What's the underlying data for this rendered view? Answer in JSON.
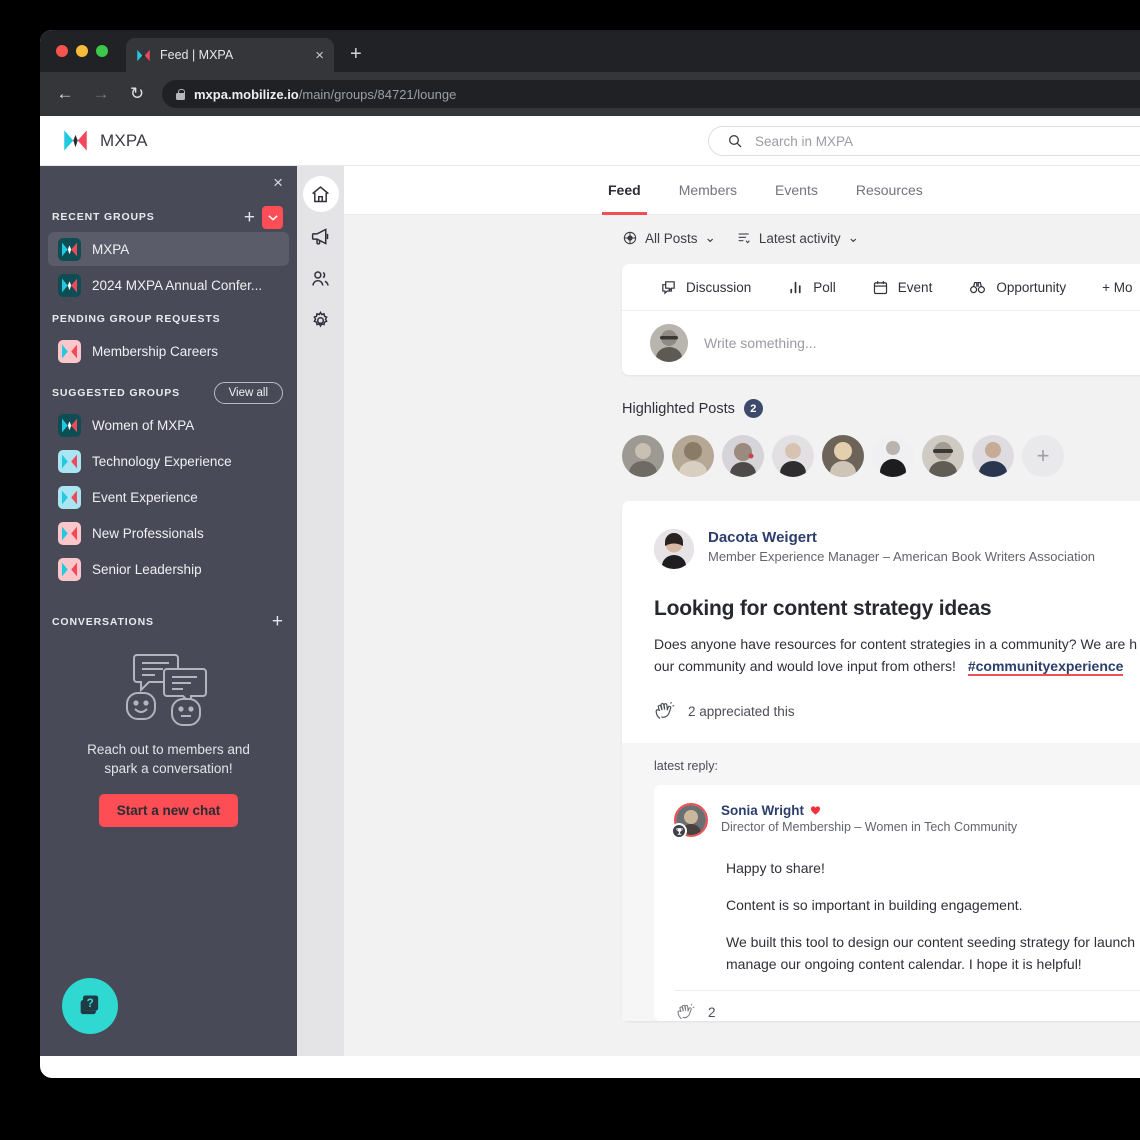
{
  "browser": {
    "tab_title": "Feed | MXPA",
    "tab_favicon": "mxpa-logo-icon",
    "close_tab": "×",
    "new_tab": "+",
    "back": "←",
    "forward": "→",
    "reload": "↻",
    "url_domain": "mxpa.mobilize.io",
    "url_path": "/main/groups/84721/lounge"
  },
  "header": {
    "brand": "MXPA",
    "search_placeholder": "Search in MXPA"
  },
  "sidebar": {
    "close": "×",
    "recent_groups_title": "RECENT GROUPS",
    "add_label": "+",
    "caret_label": "⌄",
    "recent_groups": [
      {
        "name": "MXPA",
        "tile": "dark",
        "selected": true
      },
      {
        "name": "2024 MXPA Annual Confer...",
        "tile": "dark",
        "selected": false
      }
    ],
    "pending_title": "PENDING GROUP REQUESTS",
    "pending_groups": [
      {
        "name": "Membership Careers",
        "tile": "pink"
      }
    ],
    "suggested_title": "SUGGESTED GROUPS",
    "view_all": "View all",
    "suggested_groups": [
      {
        "name": "Women of MXPA",
        "tile": "dark"
      },
      {
        "name": "Technology Experience",
        "tile": "cyan"
      },
      {
        "name": "Event Experience",
        "tile": "cyan"
      },
      {
        "name": "New Professionals",
        "tile": "pink"
      },
      {
        "name": "Senior Leadership",
        "tile": "pink"
      }
    ],
    "conversations_title": "CONVERSATIONS",
    "conversations_add": "+",
    "empty_text": "Reach out to members and spark a conversation!",
    "start_chat": "Start a new chat",
    "help_icon": "help-question-icon"
  },
  "rail": {
    "items": [
      {
        "name": "home-icon",
        "active": true
      },
      {
        "name": "megaphone-icon",
        "active": false
      },
      {
        "name": "people-icon",
        "active": false
      },
      {
        "name": "gear-icon",
        "active": false
      }
    ]
  },
  "main": {
    "tabs": [
      {
        "label": "Feed",
        "active": true
      },
      {
        "label": "Members",
        "active": false
      },
      {
        "label": "Events",
        "active": false
      },
      {
        "label": "Resources",
        "active": false
      }
    ],
    "filters": [
      {
        "label": "All Posts",
        "icon": "globe-target-icon",
        "caret": "⌄"
      },
      {
        "label": "Latest activity",
        "icon": "sort-list-icon",
        "caret": "⌄"
      }
    ],
    "composer": {
      "types": [
        {
          "label": "Discussion",
          "icon": "discussion-icon"
        },
        {
          "label": "Poll",
          "icon": "poll-bars-icon"
        },
        {
          "label": "Event",
          "icon": "calendar-icon"
        },
        {
          "label": "Opportunity",
          "icon": "binoculars-icon"
        },
        {
          "label": "+ Mo",
          "icon": "plus-icon"
        }
      ],
      "placeholder": "Write something..."
    },
    "highlighted": {
      "title": "Highlighted Posts",
      "count": "2",
      "add_label": "+",
      "avatars": 8
    },
    "post": {
      "author": "Dacota Weigert",
      "role": "Member Experience Manager – American Book Writers Association",
      "title": "Looking for content strategy ideas",
      "body_line1": "Does anyone have resources for content strategies in a community? We are h",
      "body_line2": "our community and would love input from others!",
      "hashtag": "#communityexperience",
      "appreciated": "2 appreciated this",
      "appreciate_icon": "clap-icon"
    },
    "reply": {
      "label": "latest reply:",
      "author": "Sonia Wright",
      "heart_icon": "heart-icon",
      "trophy_icon": "trophy-badge-icon",
      "role": "Director of Membership – Women in Tech Community",
      "paragraphs": [
        "Happy to share!",
        "Content is so important in building engagement.",
        "We built this tool to design our content seeding strategy for launch",
        "manage our ongoing content calendar. I hope it is helpful!"
      ],
      "appreciate_icon": "clap-icon",
      "appreciated_count": "2"
    }
  },
  "colors": {
    "accent_red": "#fc4e54",
    "sidebar": "#494a57",
    "teal": "#2fd9d2",
    "navy": "#2b3d6b"
  }
}
